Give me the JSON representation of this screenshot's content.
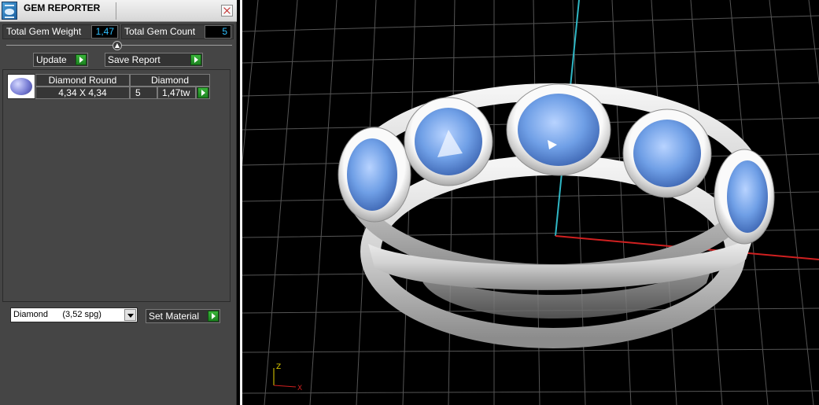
{
  "window": {
    "title": "GEM REPORTER"
  },
  "stats": {
    "weight_label": "Total Gem Weight",
    "weight_value": "1,47",
    "count_label": "Total Gem Count",
    "count_value": "5"
  },
  "actions": {
    "update_label": "Update",
    "save_label": "Save Report"
  },
  "table": {
    "headers": [
      "Diamond Round",
      "Diamond"
    ],
    "rows": [
      {
        "size": "4,34 X 4,34",
        "count": "5",
        "weight": "1,47tw"
      }
    ]
  },
  "material": {
    "selected": "Diamond      (3,52 spg)",
    "set_label": "Set Material"
  },
  "axis": {
    "x_label": "X",
    "z_label": "Z"
  },
  "colors": {
    "panel_bg": "#454545",
    "value_text": "#2fc0ff",
    "go_button": "#22a028",
    "gem_blue": "#6f9fe6",
    "viewport_bg": "#000000"
  },
  "icons": [
    "gem-reporter-app-icon",
    "close-icon",
    "collapse-icon",
    "go-arrow-icon",
    "dropdown-arrow-icon",
    "gem-thumbnail-icon"
  ]
}
